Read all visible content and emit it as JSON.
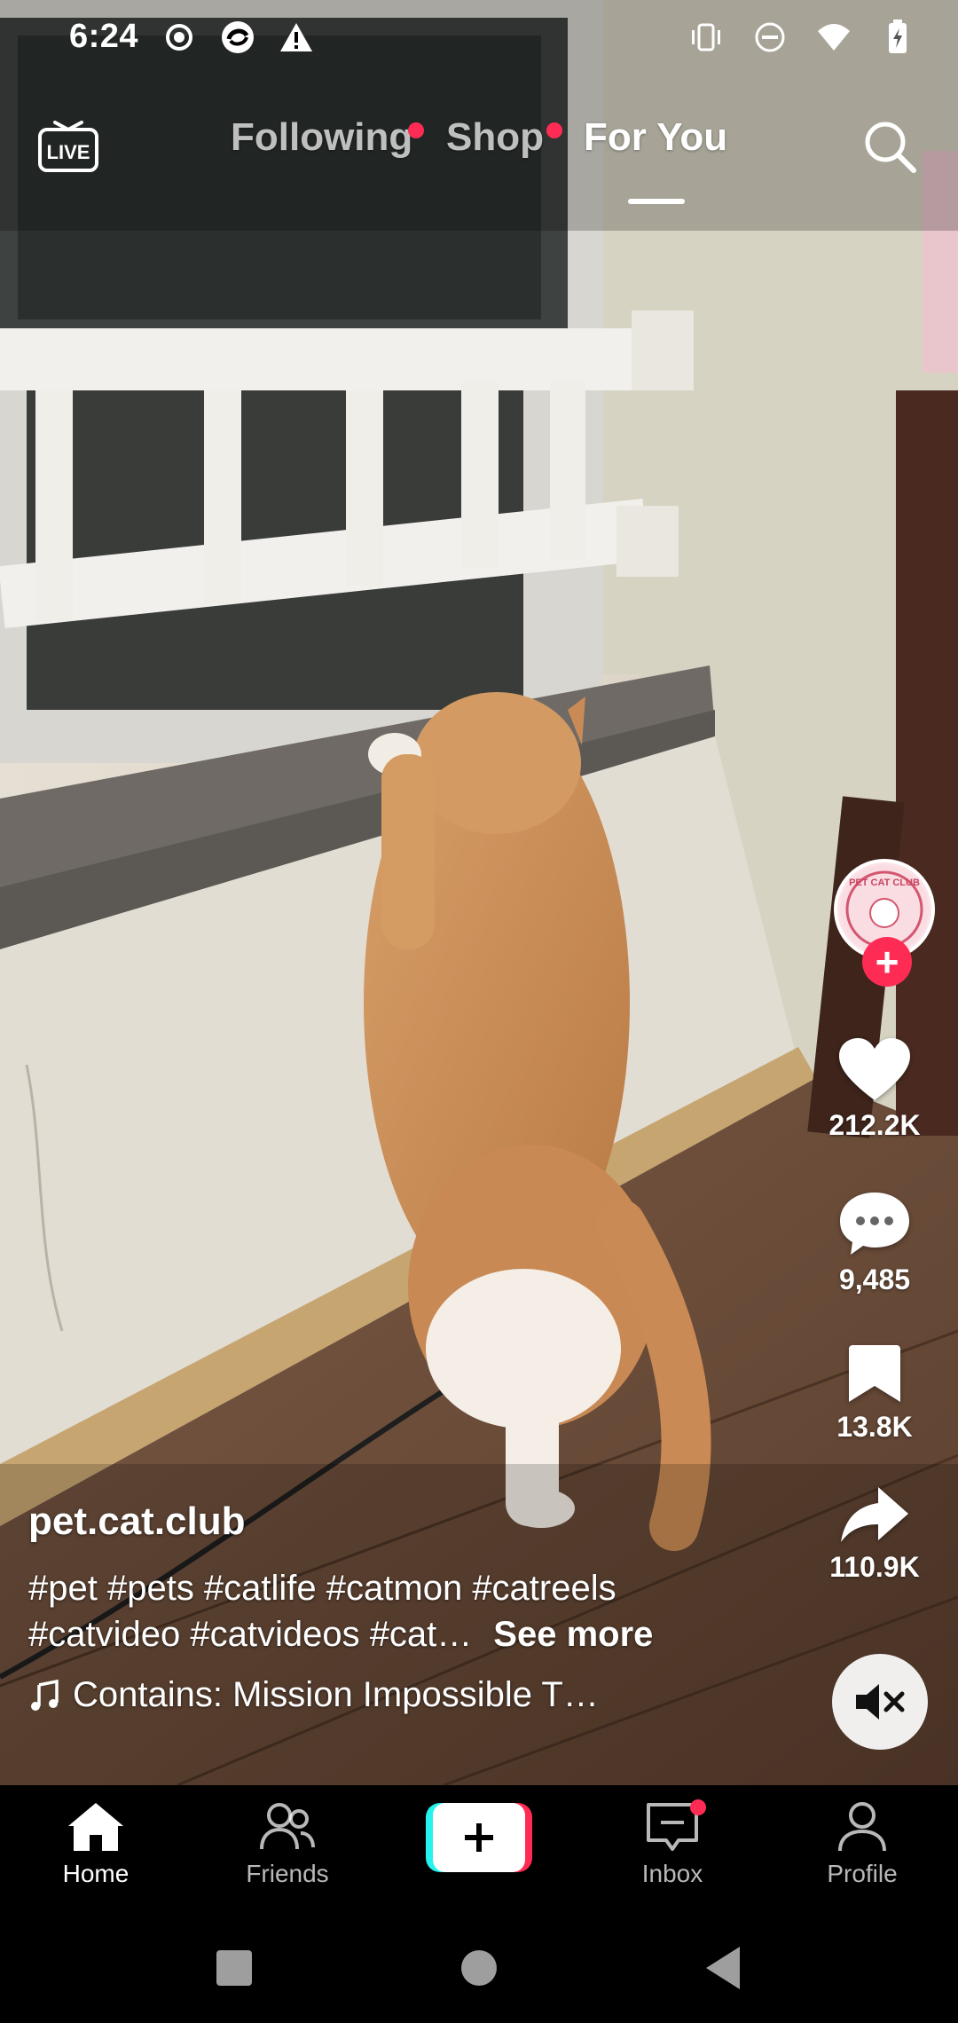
{
  "status_bar": {
    "time": "6:24",
    "left_icons": [
      "record-icon",
      "sync-app-icon",
      "warning-icon"
    ],
    "right_icons": [
      "vibrate-icon",
      "dnd-icon",
      "wifi-icon",
      "battery-charging-icon"
    ]
  },
  "top_nav": {
    "live_label": "LIVE",
    "tabs": [
      {
        "label": "Following",
        "has_dot": true,
        "active": false
      },
      {
        "label": "Shop",
        "has_dot": true,
        "active": false
      },
      {
        "label": "For You",
        "has_dot": false,
        "active": true
      }
    ],
    "search_icon": "search-icon"
  },
  "video": {
    "author_handle": "pet.cat.club",
    "hashtags_line1": "#pet #pets #catlife #catmon #catreels",
    "hashtags_line2": "#catvideo #catvideos #cat…",
    "see_more": "See more",
    "music": "Contains: Mission Impossible T…",
    "avatar_text": "PET CAT CLUB"
  },
  "actions": {
    "likes": "212.2K",
    "comments": "9,485",
    "saves": "13.8K",
    "shares": "110.9K"
  },
  "bottom_nav": {
    "home": "Home",
    "friends": "Friends",
    "inbox": "Inbox",
    "profile": "Profile",
    "inbox_has_dot": true
  },
  "colors": {
    "accent": "#fe2c55",
    "cyan": "#25f4ee",
    "background": "#000000"
  }
}
